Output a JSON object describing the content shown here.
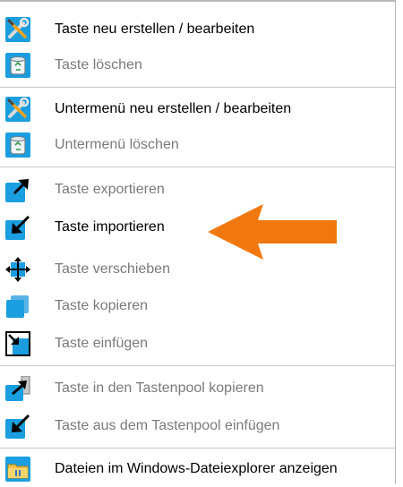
{
  "menu": {
    "items": [
      {
        "label": "Taste neu erstellen / bearbeiten",
        "icon": "tools-icon",
        "enabled": true
      },
      {
        "label": "Taste löschen",
        "icon": "recycle-bin-icon",
        "enabled": false
      },
      {
        "label": "Untermenü neu erstellen / bearbeiten",
        "icon": "tools-icon",
        "enabled": true
      },
      {
        "label": "Untermenü löschen",
        "icon": "recycle-bin-icon",
        "enabled": false
      },
      {
        "label": "Taste exportieren",
        "icon": "export-icon",
        "enabled": false
      },
      {
        "label": "Taste importieren",
        "icon": "import-icon",
        "enabled": true
      },
      {
        "label": "Taste verschieben",
        "icon": "move-icon",
        "enabled": false
      },
      {
        "label": "Taste kopieren",
        "icon": "copy-icon",
        "enabled": false
      },
      {
        "label": "Taste einfügen",
        "icon": "paste-icon",
        "enabled": false
      },
      {
        "label": "Taste in den Tastenpool kopieren",
        "icon": "pool-copy-icon",
        "enabled": false
      },
      {
        "label": "Taste aus dem Tastenpool einfügen",
        "icon": "pool-paste-icon",
        "enabled": false
      },
      {
        "label": "Dateien im Windows-Dateiexplorer anzeigen",
        "icon": "file-explorer-icon",
        "enabled": true
      }
    ]
  },
  "highlight": {
    "color": "#f0780f",
    "target": "Taste importieren"
  },
  "colors": {
    "icon_blue": "#1a9ee0",
    "disabled_text": "#7a7a7a",
    "separator": "#c8c8c8"
  }
}
